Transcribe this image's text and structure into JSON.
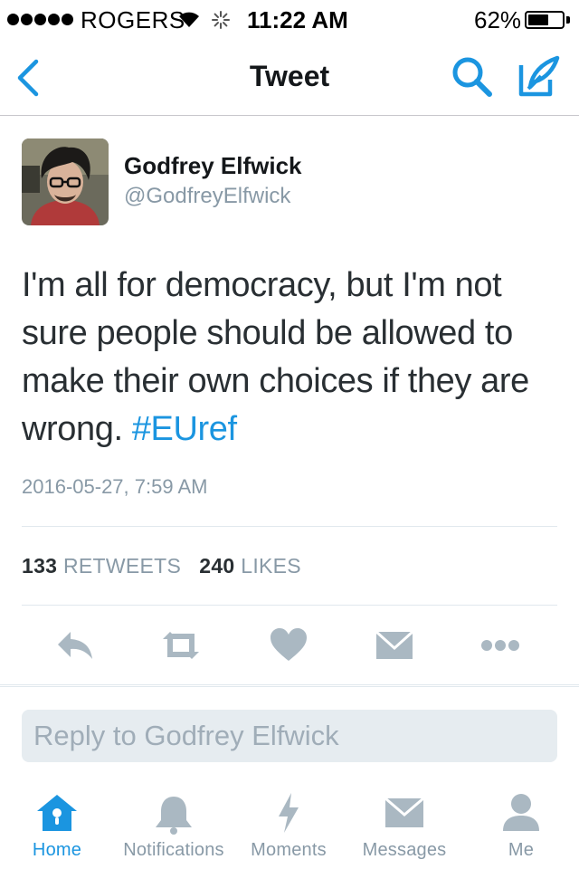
{
  "status_bar": {
    "carrier": "ROGERS",
    "time": "11:22 AM",
    "battery_percent": "62%",
    "battery_level": 0.62
  },
  "nav": {
    "title": "Tweet",
    "back_icon": "chevron-left-icon",
    "search_icon": "search-icon",
    "compose_icon": "compose-icon"
  },
  "tweet": {
    "author_name": "Godfrey Elfwick",
    "author_handle": "@GodfreyElfwick",
    "text": "I'm all for democracy, but I'm not sure people should be allowed to make their own choices if they are wrong. ",
    "hashtag": "#EUref",
    "timestamp": "2016-05-27, 7:59 AM",
    "retweets_count": "133",
    "retweets_label": "RETWEETS",
    "likes_count": "240",
    "likes_label": "LIKES"
  },
  "actions": [
    "reply-icon",
    "retweet-icon",
    "heart-icon",
    "dm-icon",
    "more-icon"
  ],
  "reply": {
    "placeholder": "Reply to Godfrey Elfwick"
  },
  "tabs": [
    {
      "label": "Home",
      "icon": "home-icon",
      "active": true
    },
    {
      "label": "Notifications",
      "icon": "bell-icon",
      "active": false
    },
    {
      "label": "Moments",
      "icon": "lightning-icon",
      "active": false
    },
    {
      "label": "Messages",
      "icon": "envelope-icon",
      "active": false
    },
    {
      "label": "Me",
      "icon": "person-icon",
      "active": false
    }
  ],
  "colors": {
    "accent": "#1b95e0",
    "muted": "#8899a6",
    "icon_gray": "#aab8c2"
  }
}
